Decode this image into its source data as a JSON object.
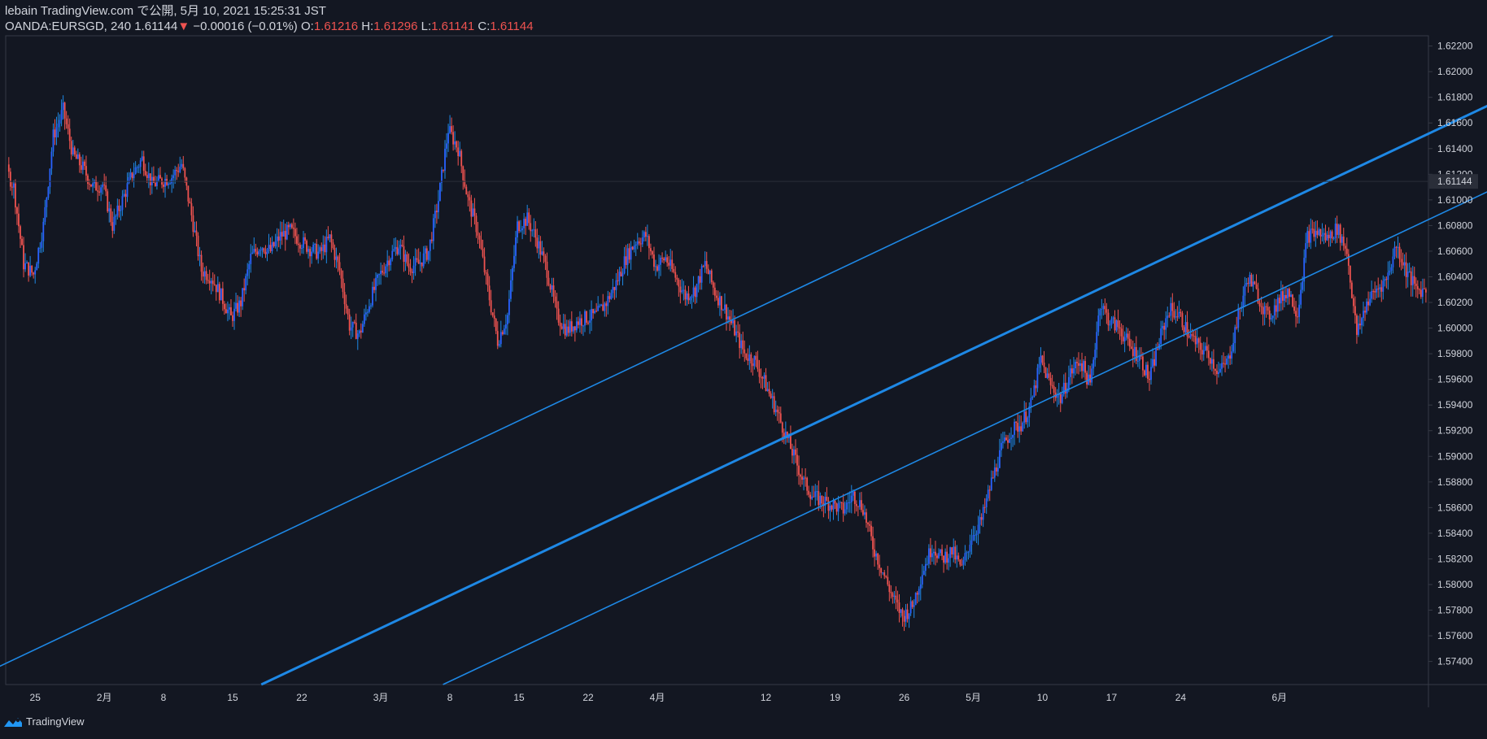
{
  "header": {
    "line1": "lebain TradingView.com で公開, 5月 10, 2021 15:25:31 JST",
    "symbol": "OANDA:EURSGD, 240",
    "last": "1.61144",
    "change_arrow": "▼",
    "change": "−0.00016 (−0.01%)",
    "o_label": "O:",
    "o_value": "1.61216",
    "h_label": "H:",
    "h_value": "1.61296",
    "l_label": "L:",
    "l_value": "1.61141",
    "c_label": "C:",
    "c_value": "1.61144"
  },
  "footer": {
    "brand": "TradingView",
    "logo_icon": "tradingview-logo-icon"
  },
  "colors": {
    "background": "#131722",
    "up": "#2962ff",
    "up_wick": "#1e88e5",
    "down": "#ef5350",
    "channel": "#1e88e5",
    "text": "#d1d4dc",
    "axis_line": "#363a45",
    "price_label_bg": "#2a2e39"
  },
  "chart_data": {
    "type": "candlestick",
    "symbol": "OANDA:EURSGD",
    "interval": "240",
    "ylim": [
      1.5722,
      1.6228
    ],
    "y_ticks": [
      "1.62200",
      "1.62000",
      "1.61800",
      "1.61600",
      "1.61400",
      "1.61200",
      "1.61000",
      "1.60800",
      "1.60600",
      "1.60400",
      "1.60200",
      "1.60000",
      "1.59800",
      "1.59600",
      "1.59400",
      "1.59200",
      "1.59000",
      "1.58800",
      "1.58600",
      "1.58400",
      "1.58200",
      "1.58000",
      "1.57800",
      "1.57600",
      "1.57400"
    ],
    "current_price": "1.61144",
    "x_ticks": [
      "25",
      "2月",
      "8",
      "15",
      "22",
      "3月",
      "8",
      "15",
      "22",
      "4月",
      "12",
      "19",
      "26",
      "5月",
      "10",
      "17",
      "24",
      "6月"
    ],
    "x_tick_days": [
      -70,
      -63,
      -57,
      -50,
      -43,
      -35,
      -28,
      -21,
      -14,
      -7,
      4,
      11,
      18,
      25,
      32,
      39,
      46,
      56
    ],
    "date_origin": "2021-04-01",
    "price_anchors": [
      [
        -77,
        1.6068
      ],
      [
        -75,
        1.6095
      ],
      [
        -73,
        1.6128
      ],
      [
        -72,
        1.611
      ],
      [
        -71,
        1.605
      ],
      [
        -70,
        1.6042
      ],
      [
        -69,
        1.608
      ],
      [
        -68,
        1.615
      ],
      [
        -67,
        1.617
      ],
      [
        -66,
        1.6135
      ],
      [
        -65,
        1.6125
      ],
      [
        -64,
        1.611
      ],
      [
        -63,
        1.6112
      ],
      [
        -62,
        1.608
      ],
      [
        -61,
        1.61
      ],
      [
        -60,
        1.612
      ],
      [
        -59,
        1.6132
      ],
      [
        -58,
        1.6112
      ],
      [
        -57,
        1.6115
      ],
      [
        -56,
        1.6118
      ],
      [
        -55,
        1.6128
      ],
      [
        -54,
        1.6088
      ],
      [
        -53,
        1.6045
      ],
      [
        -52,
        1.604
      ],
      [
        -51,
        1.6025
      ],
      [
        -50,
        1.6008
      ],
      [
        -49,
        1.602
      ],
      [
        -48,
        1.6055
      ],
      [
        -47,
        1.6065
      ],
      [
        -46,
        1.606
      ],
      [
        -45,
        1.6072
      ],
      [
        -44,
        1.6076
      ],
      [
        -43,
        1.6068
      ],
      [
        -42,
        1.6062
      ],
      [
        -41,
        1.6058
      ],
      [
        -40,
        1.607
      ],
      [
        -39,
        1.6045
      ],
      [
        -38,
        1.6002
      ],
      [
        -37,
        1.5995
      ],
      [
        -36,
        1.602
      ],
      [
        -35,
        1.604
      ],
      [
        -34,
        1.6055
      ],
      [
        -33,
        1.6065
      ],
      [
        -32,
        1.6048
      ],
      [
        -31,
        1.605
      ],
      [
        -30,
        1.606
      ],
      [
        -29,
        1.61
      ],
      [
        -28,
        1.6155
      ],
      [
        -27,
        1.614
      ],
      [
        -26,
        1.61
      ],
      [
        -25,
        1.6075
      ],
      [
        -24,
        1.603
      ],
      [
        -23,
        1.599
      ],
      [
        -22,
        1.601
      ],
      [
        -21,
        1.608
      ],
      [
        -20,
        1.6085
      ],
      [
        -19,
        1.6068
      ],
      [
        -18,
        1.6045
      ],
      [
        -17,
        1.601
      ],
      [
        -16,
        1.5998
      ],
      [
        -15,
        1.6005
      ],
      [
        -14,
        1.6008
      ],
      [
        -13,
        1.601
      ],
      [
        -12,
        1.602
      ],
      [
        -11,
        1.6035
      ],
      [
        -10,
        1.6055
      ],
      [
        -9,
        1.6068
      ],
      [
        -8,
        1.6072
      ],
      [
        -7,
        1.6048
      ],
      [
        -6,
        1.6055
      ],
      [
        -5,
        1.604
      ],
      [
        -4,
        1.6025
      ],
      [
        -3,
        1.603
      ],
      [
        -2,
        1.605
      ],
      [
        -1,
        1.6028
      ],
      [
        0,
        1.6015
      ],
      [
        1,
        1.5998
      ],
      [
        2,
        1.598
      ],
      [
        3,
        1.5975
      ],
      [
        4,
        1.5958
      ],
      [
        5,
        1.594
      ],
      [
        6,
        1.592
      ],
      [
        7,
        1.59
      ],
      [
        8,
        1.588
      ],
      [
        9,
        1.5868
      ],
      [
        10,
        1.5865
      ],
      [
        11,
        1.5862
      ],
      [
        12,
        1.5858
      ],
      [
        13,
        1.587
      ],
      [
        14,
        1.586
      ],
      [
        15,
        1.583
      ],
      [
        16,
        1.581
      ],
      [
        17,
        1.579
      ],
      [
        18,
        1.5775
      ],
      [
        19,
        1.5783
      ],
      [
        20,
        1.581
      ],
      [
        21,
        1.583
      ],
      [
        22,
        1.582
      ],
      [
        23,
        1.5826
      ],
      [
        24,
        1.5812
      ],
      [
        25,
        1.5838
      ],
      [
        26,
        1.585
      ],
      [
        27,
        1.588
      ],
      [
        28,
        1.5905
      ],
      [
        29,
        1.592
      ],
      [
        30,
        1.5925
      ],
      [
        31,
        1.594
      ],
      [
        32,
        1.5975
      ],
      [
        33,
        1.5955
      ],
      [
        34,
        1.5945
      ],
      [
        35,
        1.5965
      ],
      [
        36,
        1.5975
      ],
      [
        37,
        1.5955
      ],
      [
        38,
        1.602
      ],
      [
        39,
        1.6005
      ],
      [
        40,
        1.6
      ],
      [
        41,
        1.5985
      ],
      [
        42,
        1.5978
      ],
      [
        43,
        1.596
      ],
      [
        44,
        1.599
      ],
      [
        45,
        1.6015
      ],
      [
        46,
        1.601
      ],
      [
        47,
        1.5995
      ],
      [
        48,
        1.5985
      ],
      [
        49,
        1.598
      ],
      [
        50,
        1.5965
      ],
      [
        51,
        1.5975
      ],
      [
        52,
        1.601
      ],
      [
        53,
        1.604
      ],
      [
        54,
        1.6025
      ],
      [
        55,
        1.6008
      ],
      [
        56,
        1.602
      ],
      [
        57,
        1.603
      ],
      [
        58,
        1.6012
      ],
      [
        59,
        1.6072
      ],
      [
        60,
        1.6075
      ],
      [
        61,
        1.607
      ],
      [
        62,
        1.6078
      ],
      [
        63,
        1.606
      ],
      [
        64,
        1.5995
      ],
      [
        65,
        1.602
      ],
      [
        66,
        1.603
      ],
      [
        67,
        1.6038
      ],
      [
        68,
        1.6065
      ],
      [
        69,
        1.6045
      ],
      [
        70,
        1.603
      ],
      [
        71,
        1.603
      ],
      [
        72,
        1.606
      ],
      [
        73,
        1.608
      ],
      [
        74,
        1.6075
      ],
      [
        75,
        1.609
      ],
      [
        76,
        1.6108
      ],
      [
        77,
        1.6112
      ]
    ],
    "channel_lines": [
      {
        "role": "upper",
        "points": [
          [
            -77.5,
            1.5722
          ],
          [
            61.4,
            1.6228
          ]
        ]
      },
      {
        "role": "middle",
        "points": [
          [
            -47.1,
            1.5722
          ],
          [
            84.4,
            1.62
          ]
        ]
      },
      {
        "role": "lower",
        "points": [
          [
            -28.7,
            1.5722
          ],
          [
            84.4,
            1.6133
          ]
        ]
      }
    ]
  }
}
